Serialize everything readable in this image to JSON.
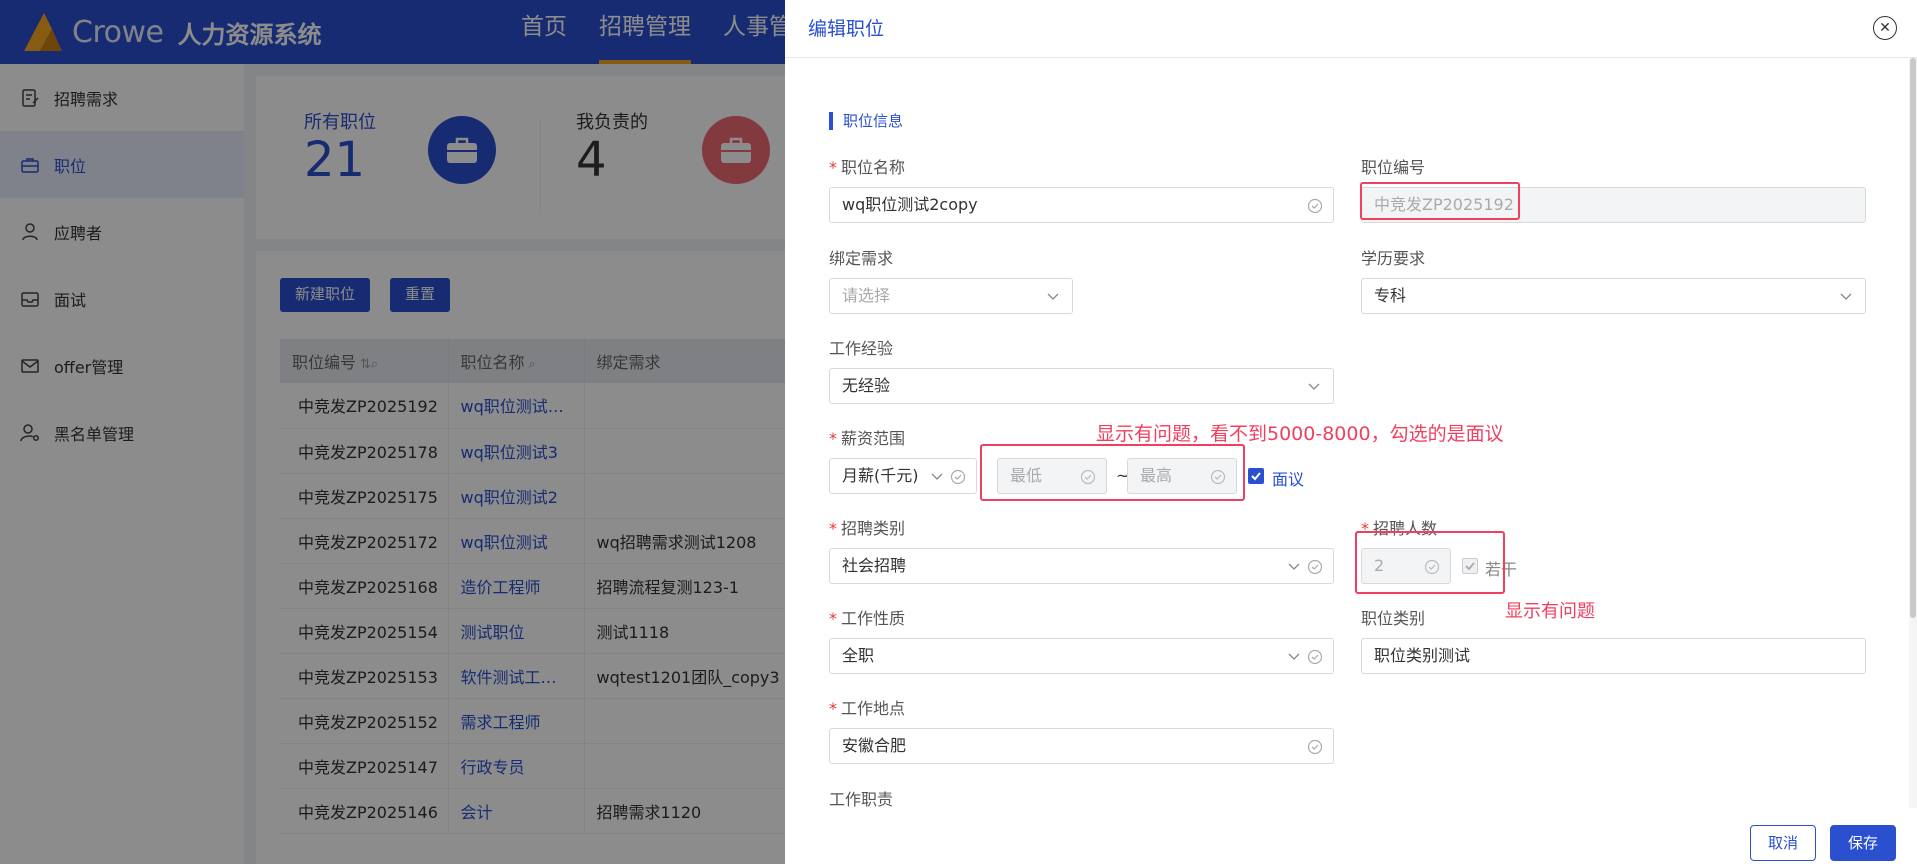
{
  "app": {
    "brand": "Crowe",
    "system_name": "人力资源系统"
  },
  "topnav": [
    "首页",
    "招聘管理",
    "人事管"
  ],
  "sidebar": {
    "items": [
      {
        "label": "招聘需求",
        "icon": "document-edit-icon"
      },
      {
        "label": "职位",
        "icon": "briefcase-icon"
      },
      {
        "label": "应聘者",
        "icon": "user-icon"
      },
      {
        "label": "面试",
        "icon": "inbox-icon"
      },
      {
        "label": "offer管理",
        "icon": "mail-icon"
      },
      {
        "label": "黑名单管理",
        "icon": "user-settings-icon"
      }
    ]
  },
  "stats": [
    {
      "label": "所有职位",
      "value": "21"
    },
    {
      "label": "我负责的",
      "value": "4"
    }
  ],
  "toolbar": {
    "new_label": "新建职位",
    "reset_label": "重置"
  },
  "table": {
    "headers": [
      "职位编号",
      "职位名称",
      "绑定需求"
    ],
    "rows": [
      {
        "code": "中竞发ZP2025192",
        "name": "wq职位测试…",
        "req": ""
      },
      {
        "code": "中竞发ZP2025178",
        "name": "wq职位测试3",
        "req": ""
      },
      {
        "code": "中竞发ZP2025175",
        "name": "wq职位测试2",
        "req": ""
      },
      {
        "code": "中竞发ZP2025172",
        "name": "wq职位测试",
        "req": "wq招聘需求测试1208"
      },
      {
        "code": "中竞发ZP2025168",
        "name": "造价工程师",
        "req": "招聘流程复测123-1"
      },
      {
        "code": "中竞发ZP2025154",
        "name": "测试职位",
        "req": "测试1118"
      },
      {
        "code": "中竞发ZP2025153",
        "name": "软件测试工…",
        "req": "wqtest1201团队_copy3"
      },
      {
        "code": "中竞发ZP2025152",
        "name": "需求工程师",
        "req": ""
      },
      {
        "code": "中竞发ZP2025147",
        "name": "行政专员",
        "req": ""
      },
      {
        "code": "中竞发ZP2025146",
        "name": "会计",
        "req": "招聘需求1120"
      }
    ]
  },
  "drawer": {
    "title": "编辑职位",
    "section": "职位信息",
    "fields": {
      "position_name": {
        "label": "职位名称",
        "value": "wq职位测试2copy"
      },
      "position_code": {
        "label": "职位编号",
        "value": "中竞发ZP2025192"
      },
      "bind_req": {
        "label": "绑定需求",
        "placeholder": "请选择"
      },
      "education": {
        "label": "学历要求",
        "value": "专科"
      },
      "experience": {
        "label": "工作经验",
        "value": "无经验"
      },
      "salary": {
        "label": "薪资范围",
        "unit": "月薪(千元)",
        "min_placeholder": "最低",
        "max_placeholder": "最高",
        "separator": "~",
        "negotiable_label": "面议",
        "negotiable_checked": true
      },
      "category": {
        "label": "招聘类别",
        "value": "社会招聘"
      },
      "headcount": {
        "label": "招聘人数",
        "value": "2",
        "many_label": "若干",
        "many_checked": true
      },
      "nature": {
        "label": "工作性质",
        "value": "全职"
      },
      "job_type": {
        "label": "职位类别",
        "value": "职位类别测试"
      },
      "location": {
        "label": "工作地点",
        "value": "安徽合肥"
      },
      "duty": {
        "label": "工作职责"
      }
    },
    "annotations": {
      "salary_note": "显示有问题，看不到5000-8000，勾选的是面议",
      "headcount_note": "显示有问题"
    },
    "footer": {
      "cancel_label": "取消",
      "save_label": "保存"
    }
  },
  "colors": {
    "primary": "#2a4fcf",
    "accent": "#f7a623",
    "annotation": "#f04060",
    "required": "#e53935"
  }
}
